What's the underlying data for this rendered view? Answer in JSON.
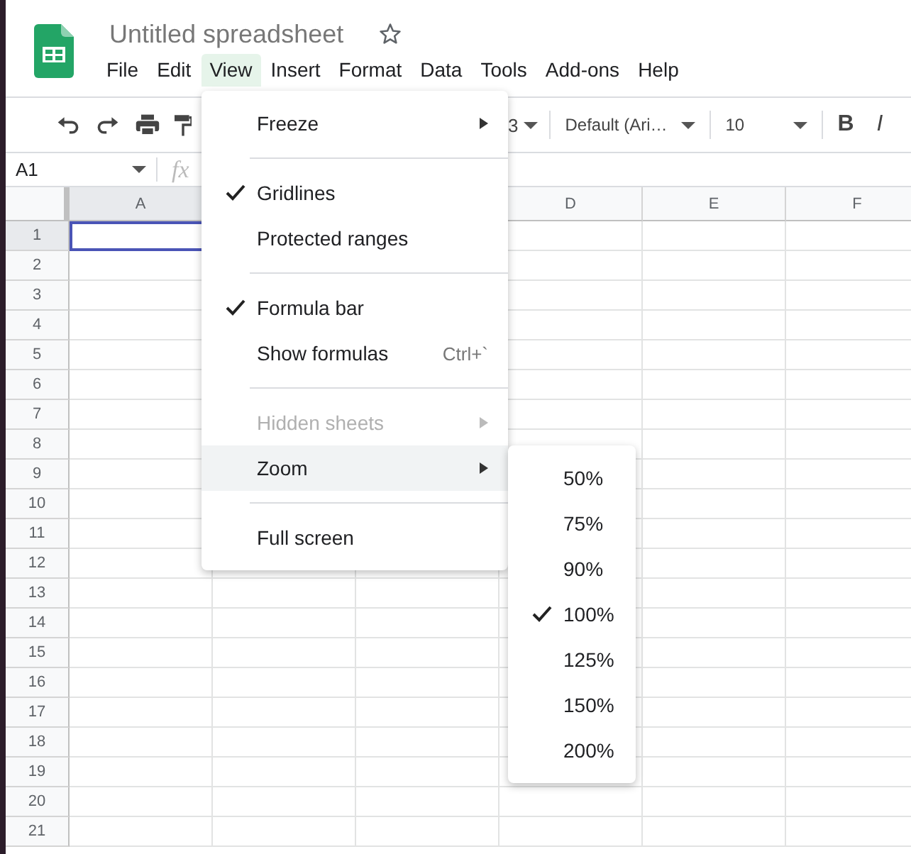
{
  "document": {
    "title": "Untitled spreadsheet"
  },
  "menu_bar": [
    {
      "label": "File",
      "selected": false
    },
    {
      "label": "Edit",
      "selected": false
    },
    {
      "label": "View",
      "selected": true
    },
    {
      "label": "Insert",
      "selected": false
    },
    {
      "label": "Format",
      "selected": false
    },
    {
      "label": "Data",
      "selected": false
    },
    {
      "label": "Tools",
      "selected": false
    },
    {
      "label": "Add-ons",
      "selected": false
    },
    {
      "label": "Help",
      "selected": false
    }
  ],
  "toolbar": {
    "number_format": "3",
    "font": "Default (Ari…",
    "font_size": "10",
    "bold": "B",
    "italic": "I"
  },
  "formula_bar": {
    "name_box": "A1",
    "fx": "fx"
  },
  "columns": [
    {
      "label": "A",
      "selected": true
    },
    null,
    null,
    {
      "label": "D",
      "selected": false
    },
    {
      "label": "E",
      "selected": false
    },
    {
      "label": "F",
      "selected": false
    }
  ],
  "rows": [
    {
      "label": "1",
      "selected": true
    },
    {
      "label": "2",
      "selected": false
    },
    {
      "label": "3",
      "selected": false
    },
    {
      "label": "4",
      "selected": false
    },
    {
      "label": "5",
      "selected": false
    },
    {
      "label": "6",
      "selected": false
    },
    {
      "label": "7",
      "selected": false
    },
    {
      "label": "8",
      "selected": false
    },
    {
      "label": "9",
      "selected": false
    },
    {
      "label": "10",
      "selected": false
    },
    {
      "label": "11",
      "selected": false
    },
    {
      "label": "12",
      "selected": false
    },
    {
      "label": "13",
      "selected": false
    },
    {
      "label": "14",
      "selected": false
    },
    {
      "label": "15",
      "selected": false
    },
    {
      "label": "16",
      "selected": false
    },
    {
      "label": "17",
      "selected": false
    },
    {
      "label": "18",
      "selected": false
    },
    {
      "label": "19",
      "selected": false
    },
    {
      "label": "20",
      "selected": false
    },
    {
      "label": "21",
      "selected": false
    }
  ],
  "view_menu": [
    {
      "kind": "item",
      "label": "Freeze",
      "checked": false,
      "disabled": false,
      "submenu": true,
      "selected": false
    },
    {
      "kind": "separator"
    },
    {
      "kind": "item",
      "label": "Gridlines",
      "checked": true,
      "disabled": false,
      "submenu": false,
      "selected": false
    },
    {
      "kind": "item",
      "label": "Protected ranges",
      "checked": false,
      "disabled": false,
      "submenu": false,
      "selected": false
    },
    {
      "kind": "separator"
    },
    {
      "kind": "item",
      "label": "Formula bar",
      "checked": true,
      "disabled": false,
      "submenu": false,
      "selected": false
    },
    {
      "kind": "item",
      "label": "Show formulas",
      "shortcut": "Ctrl+`",
      "checked": false,
      "disabled": false,
      "submenu": false,
      "selected": false
    },
    {
      "kind": "separator"
    },
    {
      "kind": "item",
      "label": "Hidden sheets",
      "checked": false,
      "disabled": true,
      "submenu": true,
      "selected": false
    },
    {
      "kind": "item",
      "label": "Zoom",
      "checked": false,
      "disabled": false,
      "submenu": true,
      "selected": true
    },
    {
      "kind": "separator"
    },
    {
      "kind": "item",
      "label": "Full screen",
      "checked": false,
      "disabled": false,
      "submenu": false,
      "selected": false
    }
  ],
  "zoom_menu": [
    {
      "label": "50%",
      "checked": false
    },
    {
      "label": "75%",
      "checked": false
    },
    {
      "label": "90%",
      "checked": false
    },
    {
      "label": "100%",
      "checked": true
    },
    {
      "label": "125%",
      "checked": false
    },
    {
      "label": "150%",
      "checked": false
    },
    {
      "label": "200%",
      "checked": false
    }
  ]
}
